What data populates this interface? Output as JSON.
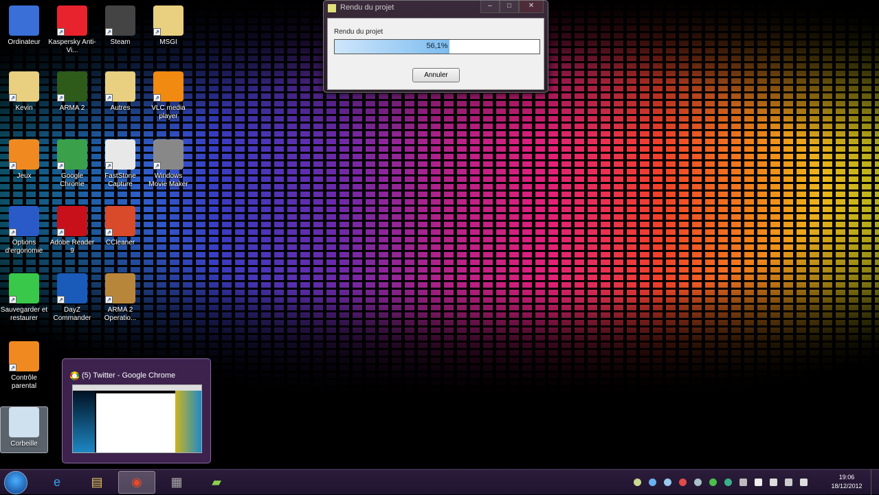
{
  "desktop": {
    "icons": [
      {
        "label": "Ordinateur",
        "color": "#3a6fd8",
        "col": 0,
        "row": 0
      },
      {
        "label": "Kaspersky Anti-Vi...",
        "color": "#e8232e",
        "col": 1,
        "row": 0
      },
      {
        "label": "Steam",
        "color": "#444",
        "col": 2,
        "row": 0
      },
      {
        "label": "MSGI",
        "color": "#e8d080",
        "col": 3,
        "row": 0
      },
      {
        "label": "Kevin",
        "color": "#e8d080",
        "col": 0,
        "row": 1
      },
      {
        "label": "ARMA 2",
        "color": "#2e5a1a",
        "col": 1,
        "row": 1
      },
      {
        "label": "Autres",
        "color": "#e8d080",
        "col": 2,
        "row": 1
      },
      {
        "label": "VLC media player",
        "color": "#f08a10",
        "col": 3,
        "row": 1
      },
      {
        "label": "Jeux",
        "color": "#f08a20",
        "col": 0,
        "row": 2
      },
      {
        "label": "Google Chrome",
        "color": "#3aa04a",
        "col": 1,
        "row": 2
      },
      {
        "label": "FastStone Capture",
        "color": "#e8e8e8",
        "col": 2,
        "row": 2
      },
      {
        "label": "Windows Movie Maker",
        "color": "#888",
        "col": 3,
        "row": 2
      },
      {
        "label": "Options d'ergonomie",
        "color": "#2a5ac8",
        "col": 0,
        "row": 3
      },
      {
        "label": "Adobe Reader 9",
        "color": "#c8101a",
        "col": 1,
        "row": 3
      },
      {
        "label": "CCleaner",
        "color": "#d84a2a",
        "col": 2,
        "row": 3
      },
      {
        "label": "Sauvegarder et restaurer",
        "color": "#3ac84a",
        "col": 0,
        "row": 4
      },
      {
        "label": "DayZ Commander",
        "color": "#1a5ab8",
        "col": 1,
        "row": 4
      },
      {
        "label": "ARMA 2 Operatio...",
        "color": "#b8863a",
        "col": 2,
        "row": 4
      },
      {
        "label": "Contrôle parental",
        "color": "#f08a20",
        "col": 0,
        "row": 5
      },
      {
        "label": "Corbeille",
        "color": "#cfe0ef",
        "col": 0,
        "row": 6,
        "selected": true
      }
    ]
  },
  "dialog": {
    "title": "Rendu du projet",
    "label": "Rendu du projet",
    "progress_percent": 56.1,
    "progress_text": "56,1%",
    "cancel": "Annuler",
    "minimize": "–",
    "maximize": "□",
    "close": "✕"
  },
  "preview": {
    "title": "(5) Twitter - Google Chrome"
  },
  "taskbar": {
    "items": [
      {
        "name": "internet-explorer",
        "glyph": "e",
        "color": "#3aa0f0"
      },
      {
        "name": "windows-explorer",
        "glyph": "▤",
        "color": "#e8c860"
      },
      {
        "name": "google-chrome",
        "glyph": "◉",
        "color": "#e84a2a",
        "active": true
      },
      {
        "name": "movie-maker",
        "glyph": "▦",
        "color": "#aaa"
      },
      {
        "name": "faststone",
        "glyph": "▰",
        "color": "#8ad050"
      }
    ],
    "tray": [
      "#c8d890",
      "#6ab0f0",
      "#9ac8f0",
      "#e04a4a",
      "#aac0c8",
      "#4ac04a",
      "#3ab08a",
      "#bbb",
      "#eee",
      "#ddd",
      "#ccc",
      "#ddd"
    ],
    "time": "19:06",
    "date": "18/12/2012"
  }
}
